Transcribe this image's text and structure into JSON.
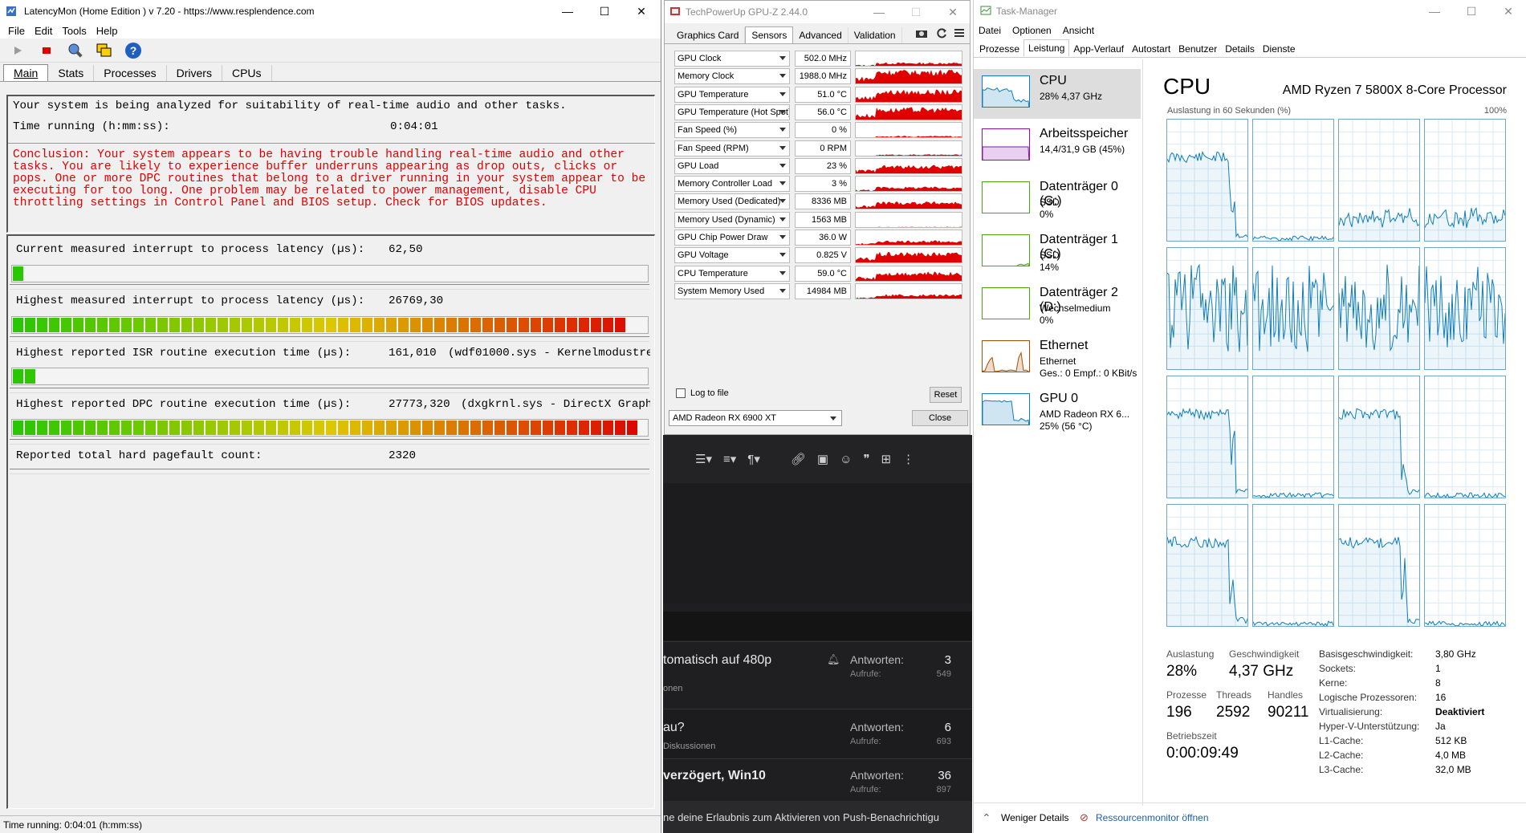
{
  "latencymon": {
    "title": "LatencyMon  (Home Edition )  v 7.20 - https://www.resplendence.com",
    "menu": [
      "File",
      "Edit",
      "Tools",
      "Help"
    ],
    "tabs": [
      "Main",
      "Stats",
      "Processes",
      "Drivers",
      "CPUs"
    ],
    "intro": "Your system is being analyzed for suitability of real-time audio and other tasks.",
    "time_label": "Time running (h:mm:ss):",
    "time_value": "0:04:01",
    "conclusion": "Conclusion: Your system appears to be having trouble handling real-time audio and other tasks. You are likely to experience buffer underruns appearing as drop outs, clicks or pops. One or more DPC routines that belong to a driver running in your system appear to be executing for too long. One problem may be related to power management, disable CPU throttling settings in Control Panel and BIOS setup. Check for BIOS updates.",
    "metrics": [
      {
        "label": "Current measured interrupt to process latency (µs):",
        "value": "62,50",
        "extra": "",
        "fill": 0.02
      },
      {
        "label": "Highest measured interrupt to process latency (µs):",
        "value": "26769,30",
        "extra": "",
        "fill": 0.96
      },
      {
        "label": "Highest reported ISR routine execution time (µs):",
        "value": "161,010",
        "extra": "(wdf01000.sys - Kernelmodustreib",
        "fill": 0.04
      },
      {
        "label": "Highest reported DPC routine execution time (µs):",
        "value": "27773,320",
        "extra": "(dxgkrnl.sys - DirectX Graphic",
        "fill": 0.98
      },
      {
        "label": "Reported total hard pagefault count:",
        "value": "2320",
        "extra": "",
        "fill": null
      }
    ],
    "status": "Time running: 0:04:01  (h:mm:ss)"
  },
  "gpuz": {
    "title": "TechPowerUp GPU-Z 2.44.0",
    "tabs": [
      "Graphics Card",
      "Sensors",
      "Advanced",
      "Validation"
    ],
    "sensors": [
      {
        "name": "GPU Clock",
        "value": "502.0 MHz",
        "level": 0.25
      },
      {
        "name": "Memory Clock",
        "value": "1988.0 MHz",
        "level": 0.8
      },
      {
        "name": "GPU Temperature",
        "value": "51.0 °C",
        "level": 0.7
      },
      {
        "name": "GPU Temperature (Hot Spot)",
        "value": "56.0 °C",
        "level": 0.7
      },
      {
        "name": "Fan Speed (%)",
        "value": "0 %",
        "level": 0.15
      },
      {
        "name": "Fan Speed (RPM)",
        "value": "0 RPM",
        "level": 0.15
      },
      {
        "name": "GPU Load",
        "value": "23 %",
        "level": 0.5
      },
      {
        "name": "Memory Controller Load",
        "value": "3 %",
        "level": 0.3
      },
      {
        "name": "Memory Used (Dedicated)",
        "value": "8336 MB",
        "level": 0.45
      },
      {
        "name": "Memory Used (Dynamic)",
        "value": "1563 MB",
        "level": 0.1
      },
      {
        "name": "GPU Chip Power Draw",
        "value": "36.0 W",
        "level": 0.3
      },
      {
        "name": "GPU Voltage",
        "value": "0.825 V",
        "level": 0.6
      },
      {
        "name": "CPU Temperature",
        "value": "59.0 °C",
        "level": 0.55
      },
      {
        "name": "System Memory Used",
        "value": "14984 MB",
        "level": 0.3
      }
    ],
    "log_label": "Log to file",
    "reset": "Reset",
    "device": "AMD Radeon RX 6900 XT",
    "close": "Close"
  },
  "forum": {
    "rows": [
      {
        "title": "tomatisch auf 480p",
        "sub": "onen",
        "answers_label": "Antworten:",
        "answers": "3",
        "views_label": "Aufrufe:",
        "views": "549"
      },
      {
        "title": "au?",
        "sub": "Diskussionen",
        "answers_label": "Antworten:",
        "answers": "6",
        "views_label": "Aufrufe:",
        "views": "693"
      },
      {
        "title": "verzögert, Win10",
        "sub": "",
        "answers_label": "Antworten:",
        "answers": "36",
        "views_label": "Aufrufe:",
        "views": "897"
      }
    ],
    "notice": "ne deine Erlaubnis zum Aktivieren von Push-Benachrichtigu"
  },
  "taskmgr": {
    "title": "Task-Manager",
    "menu": [
      "Datei",
      "Optionen",
      "Ansicht"
    ],
    "tabs": [
      "Prozesse",
      "Leistung",
      "App-Verlauf",
      "Autostart",
      "Benutzer",
      "Details",
      "Dienste"
    ],
    "side": [
      {
        "name": "CPU",
        "d1": "28% 4,37 GHz",
        "d2": "",
        "color": "#117dbb"
      },
      {
        "name": "Arbeitsspeicher",
        "d1": "14,4/31,9 GB (45%)",
        "d2": "",
        "color": "#8b12ae"
      },
      {
        "name": "Datenträger 0 (G:)",
        "d1": "SSD",
        "d2": "0%",
        "color": "#4da60c"
      },
      {
        "name": "Datenträger 1 (C:)",
        "d1": "SSD",
        "d2": "14%",
        "color": "#4da60c"
      },
      {
        "name": "Datenträger 2 (D:)",
        "d1": "Wechselmedium",
        "d2": "0%",
        "color": "#4da60c"
      },
      {
        "name": "Ethernet",
        "d1": "Ethernet",
        "d2": "Ges.: 0 Empf.: 0 KBit/s",
        "color": "#a74f01"
      },
      {
        "name": "GPU 0",
        "d1": "AMD Radeon RX 6...",
        "d2": "25% (56 °C)",
        "color": "#117dbb"
      }
    ],
    "heading": "CPU",
    "processor": "AMD Ryzen 7 5800X 8-Core Processor",
    "graph_label": "Auslastung in 60 Sekunden (%)",
    "graph_max": "100%",
    "stats": {
      "auslastung_k": "Auslastung",
      "auslastung_v": "28%",
      "geschw_k": "Geschwindigkeit",
      "geschw_v": "4,37 GHz",
      "prozesse_k": "Prozesse",
      "prozesse_v": "196",
      "threads_k": "Threads",
      "threads_v": "2592",
      "handles_k": "Handles",
      "handles_v": "90211",
      "betrieb_k": "Betriebszeit",
      "betrieb_v": "0:00:09:49"
    },
    "specs": [
      {
        "k": "Basisgeschwindigkeit:",
        "v": "3,80 GHz"
      },
      {
        "k": "Sockets:",
        "v": "1"
      },
      {
        "k": "Kerne:",
        "v": "8"
      },
      {
        "k": "Logische Prozessoren:",
        "v": "16"
      },
      {
        "k": "Virtualisierung:",
        "v": "Deaktiviert",
        "bold": true
      },
      {
        "k": "Hyper-V-Unterstützung:",
        "v": "Ja"
      },
      {
        "k": "L1-Cache:",
        "v": "512 KB"
      },
      {
        "k": "L2-Cache:",
        "v": "4,0 MB"
      },
      {
        "k": "L3-Cache:",
        "v": "32,0 MB"
      }
    ],
    "less_details": "Weniger Details",
    "resmon": "Ressourcenmonitor öffnen"
  }
}
